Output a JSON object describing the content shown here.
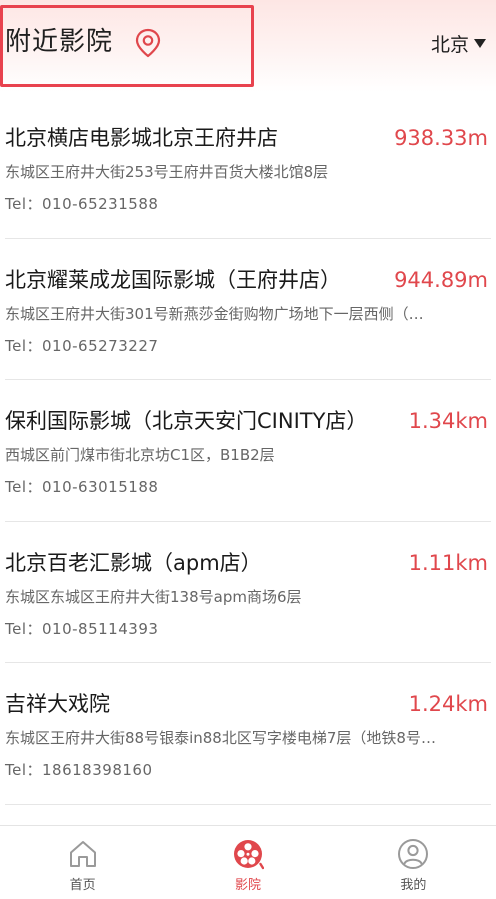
{
  "header": {
    "title": "附近影院",
    "location_icon": "map-pin-icon",
    "city": "北京",
    "accent_color": "#e0474c"
  },
  "cinemas": [
    {
      "name": "北京横店电影城北京王府井店",
      "distance": "938.33m",
      "address": "东城区王府井大街253号王府井百货大楼北馆8层",
      "tel": "Tel：010-65231588"
    },
    {
      "name": "北京耀莱成龙国际影城（王府井店）",
      "distance": "944.89m",
      "address": "东城区王府井大街301号新燕莎金街购物广场地下一层西侧（…",
      "tel": "Tel：010-65273227"
    },
    {
      "name": "保利国际影城（北京天安门CINITY店）",
      "distance": "1.34km",
      "address": "西城区前门煤市街北京坊C1区，B1B2层",
      "tel": "Tel：010-63015188"
    },
    {
      "name": "北京百老汇影城（apm店）",
      "distance": "1.11km",
      "address": "东城区东城区王府井大街138号apm商场6层",
      "tel": "Tel：010-85114393"
    },
    {
      "name": "吉祥大戏院",
      "distance": "1.24km",
      "address": "东城区王府井大街88号银泰in88北区写字楼电梯7层（地铁8号…",
      "tel": "Tel：18618398160"
    }
  ],
  "tabbar": {
    "tabs": [
      {
        "label": "首页",
        "icon": "home-icon",
        "active": false
      },
      {
        "label": "影院",
        "icon": "film-reel-icon",
        "active": true
      },
      {
        "label": "我的",
        "icon": "user-icon",
        "active": false
      }
    ]
  }
}
